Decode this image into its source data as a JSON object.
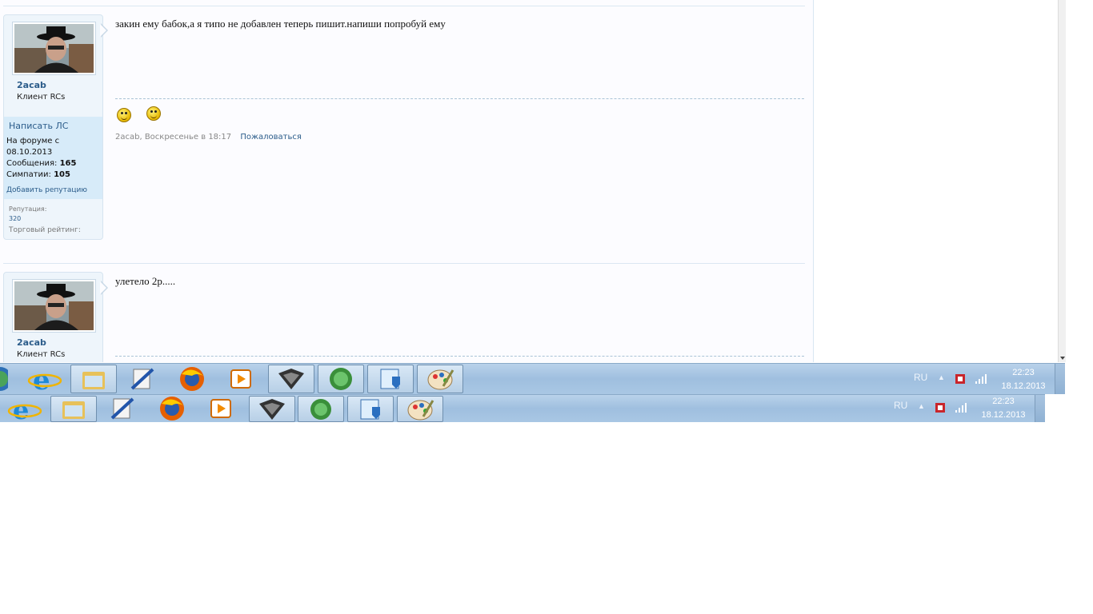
{
  "posts": [
    {
      "username": "2acab",
      "user_title": "Клиент RCs",
      "pm_label": "Написать ЛС",
      "joined_label": "На форуме с",
      "joined_date": "08.10.2013",
      "messages_label": "Сообщения:",
      "messages_count": "165",
      "likes_label": "Симпатии:",
      "likes_count": "105",
      "add_rep_label": "Добавить репутацию",
      "rep_label": "Репутация:",
      "rep_value": "320",
      "trade_label": "Торговый рейтинг:",
      "message": "закин ему бабок,а я типо не добавлен теперь пишит.напиши попробуй ему",
      "meta": "2acab, Воскресенье в 18:17",
      "report_label": "Пожаловаться"
    },
    {
      "username": "2acab",
      "user_title": "Клиент RCs",
      "message": "улетело 2р....."
    }
  ],
  "taskbars": [
    {
      "lang": "RU",
      "time": "22:23",
      "date": "18.12.2013"
    },
    {
      "lang": "RU",
      "time": "22:23",
      "date": "18.12.2013"
    }
  ]
}
